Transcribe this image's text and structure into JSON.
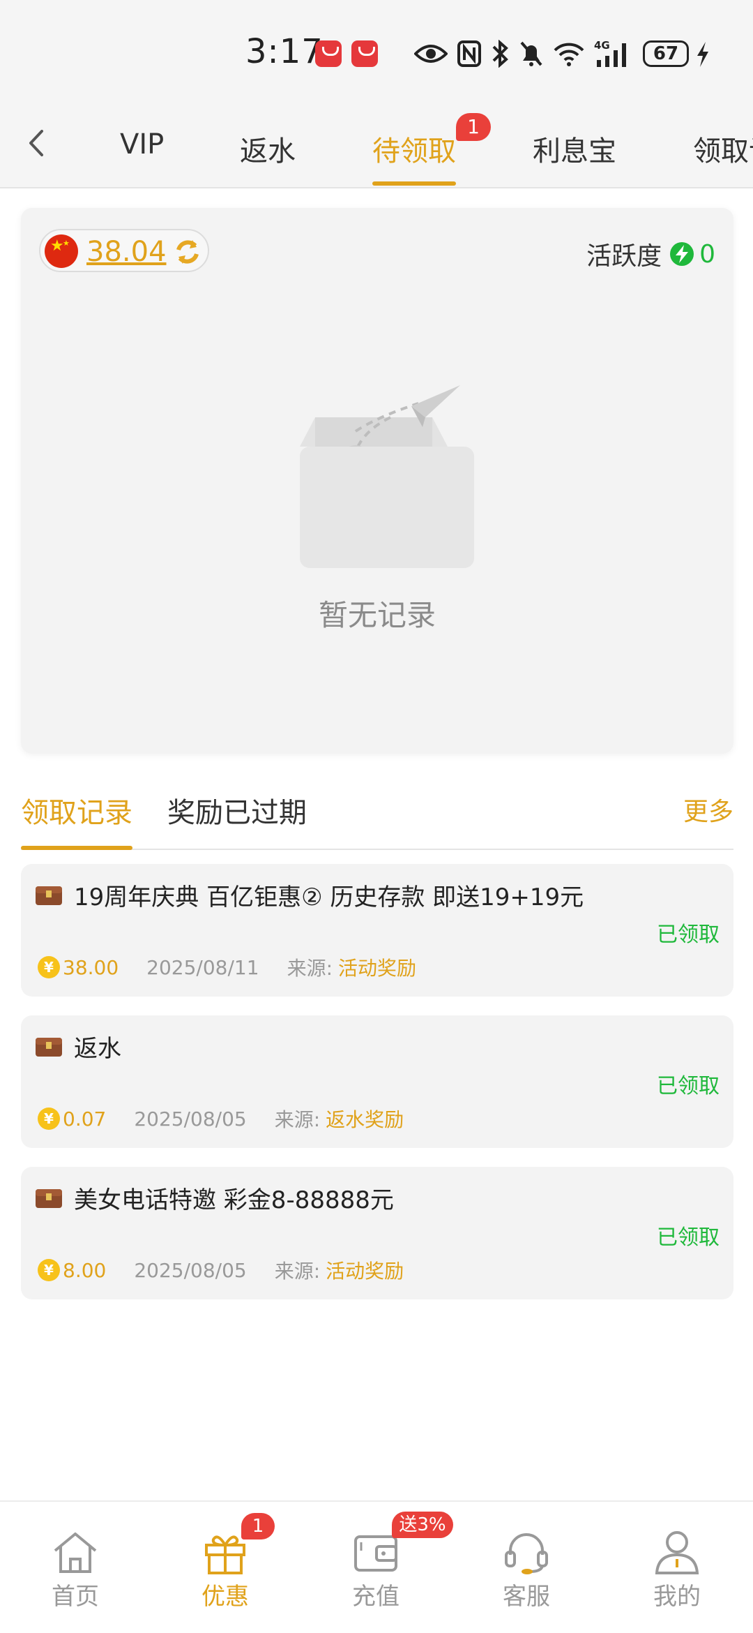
{
  "status_bar": {
    "time": "3:17",
    "battery": "67",
    "network": "4G"
  },
  "top_tabs": {
    "items": [
      {
        "label": "VIP"
      },
      {
        "label": "返水"
      },
      {
        "label": "待领取"
      },
      {
        "label": "利息宝"
      },
      {
        "label": "领取记"
      }
    ],
    "active_index": 2,
    "badge": "1"
  },
  "summary": {
    "balance": "38.04",
    "activity_label": "活跃度",
    "activity_value": "0",
    "empty_text": "暂无记录"
  },
  "section_tabs": {
    "items": [
      {
        "label": "领取记录"
      },
      {
        "label": "奖励已过期"
      }
    ],
    "more": "更多"
  },
  "records": [
    {
      "title": "19周年庆典  百亿钜惠② 历史存款 即送19+19元",
      "status": "已领取",
      "amount": "38.00",
      "date": "2025/08/11",
      "source_label": "来源:",
      "source": "活动奖励"
    },
    {
      "title": "返水",
      "status": "已领取",
      "amount": "0.07",
      "date": "2025/08/05",
      "source_label": "来源:",
      "source": "返水奖励"
    },
    {
      "title": "美女电话特邀  彩金8-88888元",
      "status": "已领取",
      "amount": "8.00",
      "date": "2025/08/05",
      "source_label": "来源:",
      "source": "活动奖励"
    }
  ],
  "bottom_nav": {
    "items": [
      {
        "label": "首页",
        "icon": "home-icon"
      },
      {
        "label": "优惠",
        "icon": "gift-icon"
      },
      {
        "label": "充值",
        "icon": "wallet-icon"
      },
      {
        "label": "客服",
        "icon": "headset-icon"
      },
      {
        "label": "我的",
        "icon": "user-icon"
      }
    ],
    "active_index": 1,
    "promo_badge": "1",
    "recharge_badge": "送3%"
  },
  "colors": {
    "accent": "#e0a21b",
    "success": "#1fb83b",
    "badge": "#e9403a"
  }
}
